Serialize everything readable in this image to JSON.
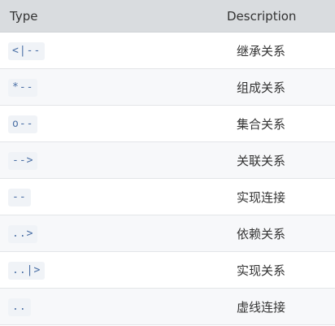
{
  "header": {
    "type_label": "Type",
    "description_label": "Description"
  },
  "rows": [
    {
      "type": "<|--",
      "description": "继承关系"
    },
    {
      "type": "*--",
      "description": "组成关系"
    },
    {
      "type": "o--",
      "description": "集合关系"
    },
    {
      "type": "-->",
      "description": "关联关系"
    },
    {
      "type": "--",
      "description": "实现连接"
    },
    {
      "type": "..>",
      "description": "依赖关系"
    },
    {
      "type": "..|>",
      "description": "实现关系"
    },
    {
      "type": "..",
      "description": "虚线连接"
    }
  ]
}
